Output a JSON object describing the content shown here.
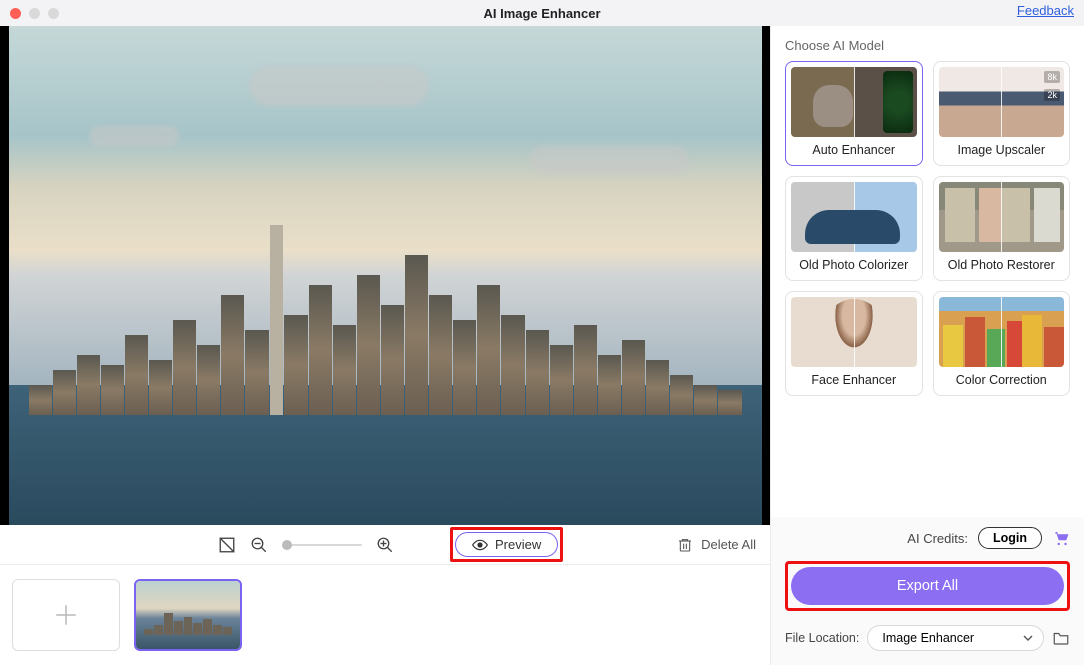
{
  "titlebar": {
    "title": "AI Image Enhancer",
    "feedback": "Feedback"
  },
  "toolbar": {
    "preview_label": "Preview",
    "delete_all_label": "Delete All"
  },
  "sidebar": {
    "choose_label": "Choose AI Model",
    "models": [
      {
        "label": "Auto Enhancer"
      },
      {
        "label": "Image Upscaler"
      },
      {
        "label": "Old Photo Colorizer"
      },
      {
        "label": "Old Photo Restorer"
      },
      {
        "label": "Face Enhancer"
      },
      {
        "label": "Color Correction"
      }
    ],
    "upscaler_badges": {
      "hi": "8k",
      "lo": "2k"
    }
  },
  "footer": {
    "credits_label": "AI Credits:",
    "login_label": "Login",
    "export_label": "Export All",
    "file_location_label": "File Location:",
    "file_location_value": "Image Enhancer"
  }
}
